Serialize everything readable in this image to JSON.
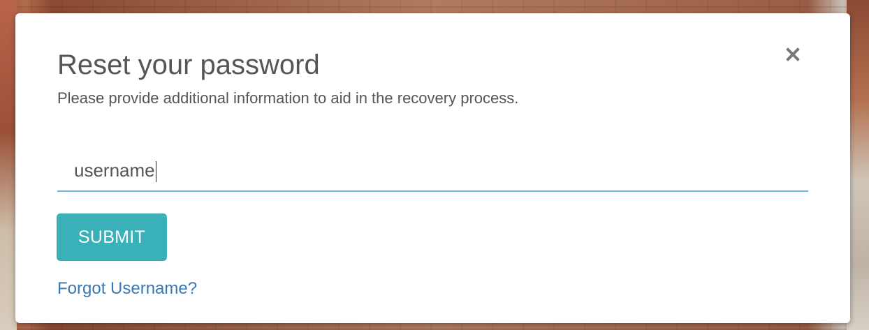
{
  "dialog": {
    "title": "Reset your password",
    "subtitle": "Please provide additional information to aid in the recovery process.",
    "close_icon": "close-icon",
    "username_field": {
      "value": "username"
    },
    "submit_label": "SUBMIT",
    "forgot_username_link": "Forgot Username?"
  },
  "colors": {
    "accent": "#3ab0b8",
    "link": "#3a78b5",
    "field_underline": "#6db3d6",
    "text": "#555555"
  }
}
